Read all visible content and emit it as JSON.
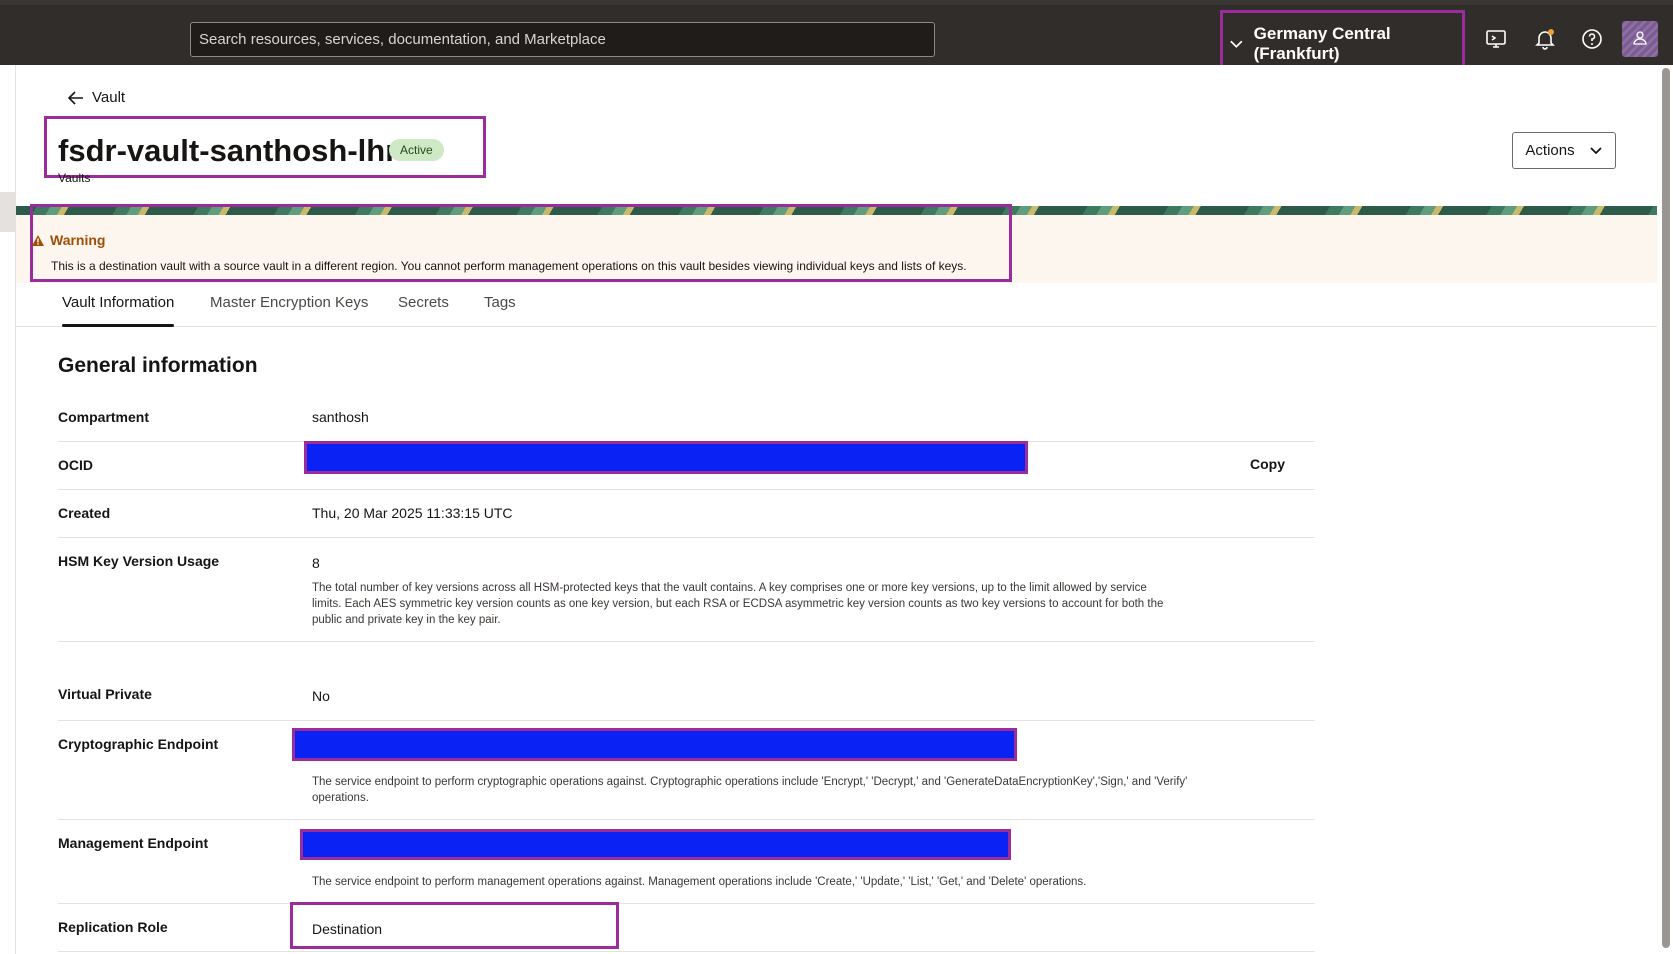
{
  "topbar": {
    "search_placeholder": "Search resources, services, documentation, and Marketplace",
    "region": "Germany Central (Frankfurt)",
    "icons": [
      "chevron-down-icon",
      "cloud-shell-icon",
      "bell-icon",
      "help-icon",
      "user-icon"
    ]
  },
  "header": {
    "back_label": "Vault",
    "title": "fsdr-vault-santhosh-lhr",
    "status": "Active",
    "subtitle": "Vaults",
    "actions_label": "Actions"
  },
  "warning": {
    "title": "Warning",
    "text": "This is a destination vault with a source vault in a different region. You cannot perform management operations on this vault besides viewing individual keys and lists of keys."
  },
  "tabs": [
    {
      "label": "Vault Information",
      "active": true
    },
    {
      "label": "Master Encryption Keys",
      "active": false
    },
    {
      "label": "Secrets",
      "active": false
    },
    {
      "label": "Tags",
      "active": false
    }
  ],
  "general": {
    "title": "General information",
    "compartment": {
      "label": "Compartment",
      "value": "santhosh"
    },
    "ocid": {
      "label": "OCID",
      "copy_label": "Copy"
    },
    "created": {
      "label": "Created",
      "value": "Thu, 20 Mar 2025 11:33:15 UTC"
    },
    "hsm": {
      "label": "HSM Key Version Usage",
      "value": "8",
      "desc_lines": [
        "The total number of key versions across all HSM-protected keys that the vault contains. A key comprises one or more key versions, up to the limit allowed by service",
        "limits. Each AES symmetric key version counts as one key version, but each RSA or ECDSA asymmetric key version counts as two key versions to account for both the",
        "public and private key in the key pair."
      ]
    },
    "virtual_private": {
      "label": "Virtual Private",
      "value": "No"
    },
    "crypto_endpoint": {
      "label": "Cryptographic Endpoint",
      "desc_lines": [
        "The service endpoint to perform cryptographic operations against. Cryptographic operations include 'Encrypt,' 'Decrypt,' and 'GenerateDataEncryptionKey','Sign,' and 'Verify'",
        "operations."
      ]
    },
    "mgmt_endpoint": {
      "label": "Management Endpoint",
      "desc": "The service endpoint to perform management operations against. Management operations include 'Create,' 'Update,' 'List,' 'Get,' and 'Delete' operations."
    },
    "replication_role": {
      "label": "Replication Role",
      "value": "Destination"
    }
  },
  "colors": {
    "topbar": "#312d2a",
    "highlight": "#9b2c9b",
    "redaction": "#0b22f5",
    "warning_title": "#9e4e05",
    "status_badge": "#cfe8c5"
  }
}
